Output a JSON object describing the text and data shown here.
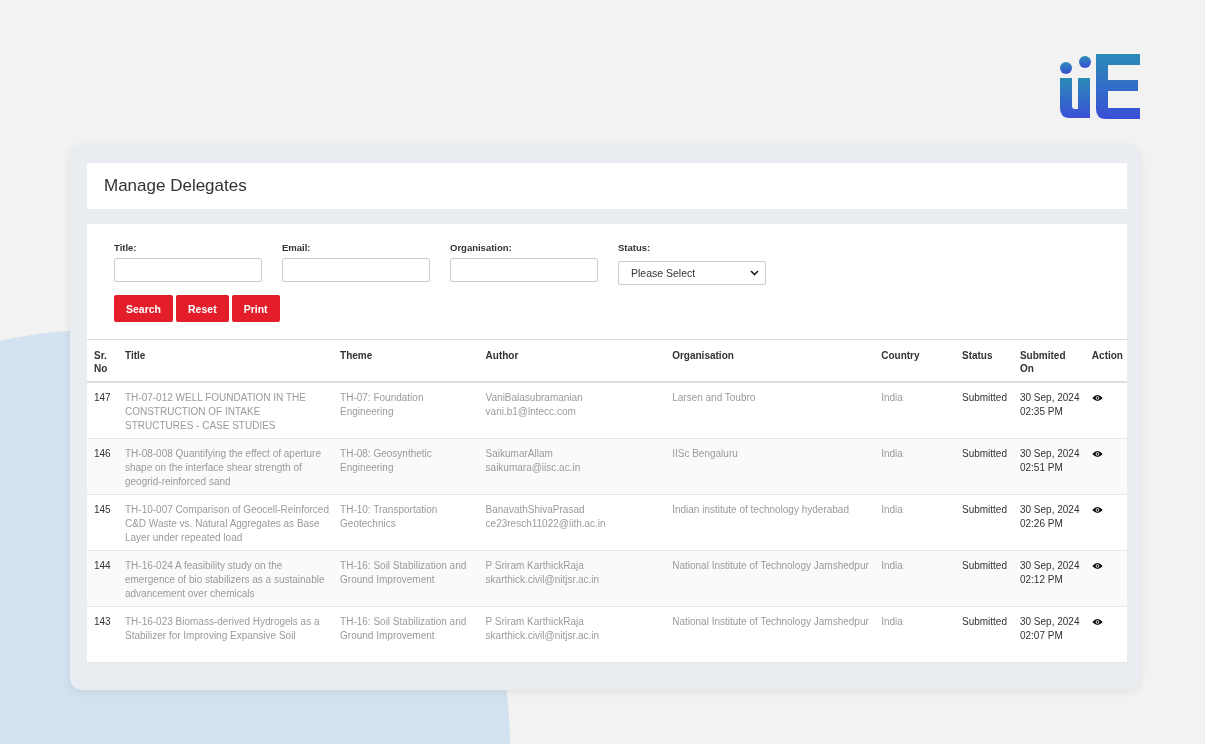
{
  "page": {
    "title": "Manage Delegates"
  },
  "filters": [
    {
      "label": "Title:",
      "kind": "text"
    },
    {
      "label": "Email:",
      "kind": "text"
    },
    {
      "label": "Organisation:",
      "kind": "text"
    },
    {
      "label": "Status:",
      "kind": "select",
      "value": "Please Select"
    }
  ],
  "buttons": [
    "Search",
    "Reset",
    "Print"
  ],
  "table": {
    "columns": [
      {
        "label": "Sr. No",
        "kind": "plain"
      },
      {
        "label": "Title",
        "kind": "blurred"
      },
      {
        "label": "Theme",
        "kind": "blurred"
      },
      {
        "label": "Author",
        "kind": "blurred"
      },
      {
        "label": "Organisation",
        "kind": "blurred"
      },
      {
        "label": "Country",
        "kind": "blurred"
      },
      {
        "label": "Status",
        "kind": "plain"
      },
      {
        "label": "Submited On",
        "kind": "plain"
      },
      {
        "label": "Action",
        "kind": "action"
      }
    ],
    "rows": [
      {
        "cells": [
          "147",
          "TH-07-012  WELL FOUNDATION IN THE CONSTRUCTION OF INTAKE STRUCTURES - CASE STUDIES",
          "TH-07: Foundation Engineering",
          "VaniBalasubramanian vani.b1@lntecc.com",
          "Larsen and Toubro",
          "India",
          "Submitted",
          "30 Sep, 2024 02:35 PM"
        ]
      },
      {
        "cells": [
          "146",
          "TH-08-008  Quantifying the effect of aperture shape on the interface shear strength of geogrid-reinforced sand",
          "TH-08: Geosynthetic Engineering",
          "SaikumarAllam\nsaikumara@iisc.ac.in",
          "IISc Bengaluru",
          "India",
          "Submitted",
          "30 Sep, 2024 02:51 PM"
        ]
      },
      {
        "cells": [
          "145",
          "TH-10-007  Comparison of Geocell-Reinforced C&D Waste vs. Natural Aggregates as Base Layer under repeated load",
          "TH-10: Transportation Geotechnics",
          "BanavathShivaPrasad ce23resch11022@iith.ac.in",
          "Indian institute of technology hyderabad",
          "India",
          "Submitted",
          "30 Sep, 2024 02:26 PM"
        ]
      },
      {
        "cells": [
          "144",
          "TH-16-024  A feasibility study on the emergence of bio stabilizers as a sustainable advancement over chemicals",
          "TH-16: Soil Stabilization and Ground Improvement",
          "P Sriram KarthickRaja skarthick.civil@nitjsr.ac.in",
          "National Institute of Technology Jamshedpur",
          "India",
          "Submitted",
          "30 Sep, 2024 02:12 PM"
        ]
      },
      {
        "cells": [
          "143",
          "TH-16-023  Biomass-derived Hydrogels as a Stabilizer for Improving Expansive Soil",
          "TH-16: Soil Stabilization and Ground Improvement",
          "P Sriram KarthickRaja skarthick.civil@nitjsr.ac.in",
          "National Institute of Technology Jamshedpur",
          "India",
          "Submitted",
          "30 Sep, 2024 02:07 PM"
        ]
      }
    ]
  }
}
